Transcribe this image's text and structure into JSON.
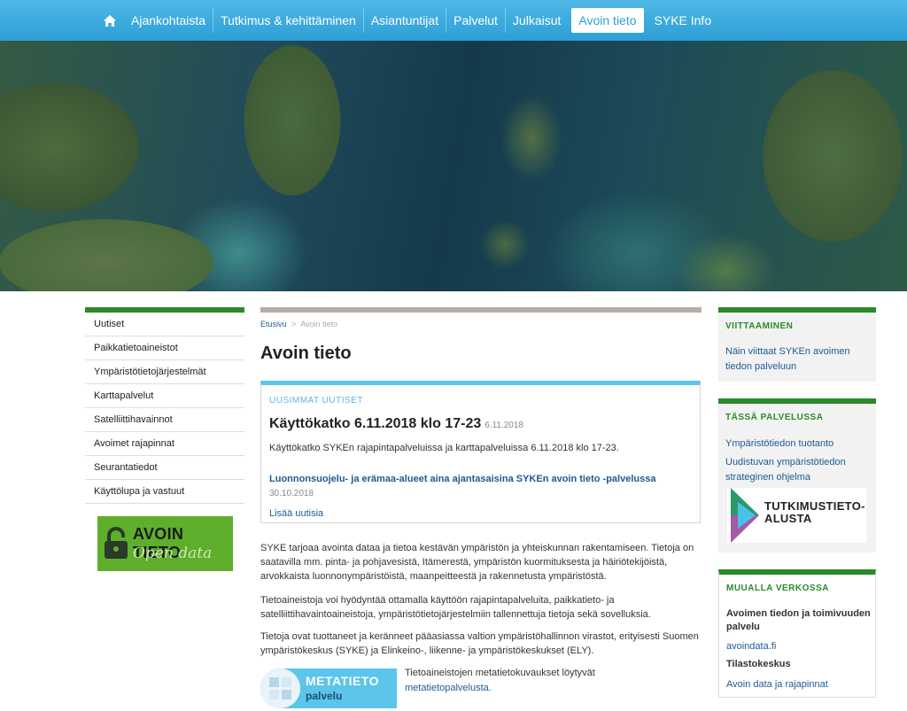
{
  "nav": {
    "home_icon": "home-icon",
    "items": [
      {
        "label": "Ajankohtaista"
      },
      {
        "label": "Tutkimus & kehittäminen"
      },
      {
        "label": "Asiantuntijat"
      },
      {
        "label": "Palvelut"
      },
      {
        "label": "Julkaisut"
      },
      {
        "label": "Avoin tieto",
        "active": true
      },
      {
        "label": "SYKE Info"
      }
    ],
    "bg_color": "#2d9fd6"
  },
  "left_nav": {
    "items": [
      {
        "label": "Uutiset"
      },
      {
        "label": "Paikkatietoaineistot"
      },
      {
        "label": "Ympäristötietojärjestelmät"
      },
      {
        "label": "Karttapalvelut"
      },
      {
        "label": "Satelliittihavainnot"
      },
      {
        "label": "Avoimet rajapinnat"
      },
      {
        "label": "Seurantatiedot"
      },
      {
        "label": "Käyttölupa ja vastuut"
      }
    ],
    "logo_line1": "AVOIN TIETO",
    "logo_line2": "Open data",
    "accent": "#2a8a2a"
  },
  "breadcrumb": {
    "home": "Etusivu",
    "sep": ">",
    "current": "Avoin tieto"
  },
  "page_title": "Avoin tieto",
  "news": {
    "heading": "UUSIMMAT UUTISET",
    "item1_title": "Käyttökatko 6.11.2018 klo 17-23",
    "item1_date": "6.11.2018",
    "item1_body": "Käyttökatko SYKEn rajapintapalveluissa ja karttapalveluissa 6.11.2018 klo 17-23.",
    "item2_title": "Luonnonsuojelu- ja erämaa-alueet aina ajantasaisina SYKEn avoin tieto -palvelussa",
    "item2_date": "30.10.2018",
    "more": "Lisää uutisia"
  },
  "paragraphs": [
    "SYKE tarjoaa avointa dataa ja tietoa kestävän ympäristön ja yhteiskunnan rakentamiseen. Tietoja on saatavilla mm. pinta- ja pohjavesistä, Itämerestä, ympäristön kuormituksesta ja häiriötekijöistä, arvokkaista luonnonympäristöistä, maanpeitteestä ja rakennetusta ympäristöstä.",
    "Tietoaineistoja voi hyödyntää ottamalla käyttöön rajapintapalveluita, paikkatieto- ja satelliittihavaintoaineistoja, ympäristötietojärjestelmiin tallennettuja tietoja sekä sovelluksia.",
    "Tietoja ovat tuottaneet ja keränneet pääasiassa valtion ympäristöhallinnon virastot, erityisesti  Suomen ympäristökeskus (SYKE) ja Elinkeino-, liikenne- ja ympäristökeskukset (ELY)."
  ],
  "meta": {
    "logo_line1": "METATIETO",
    "logo_line2": "palvelu",
    "text": "Tietoaineistojen metatietokuvaukset löytyvät",
    "link": "metatietopalvelusta."
  },
  "sidebar": {
    "viittaaminen": {
      "title": "VIITTAAMINEN",
      "link": "Näin viittaat SYKEn avoimen tiedon palveluun"
    },
    "tassa": {
      "title": "TÄSSÄ PALVELUSSA",
      "link1": "Ympäristötiedon tuotanto",
      "link2": "Uudistuvan ympäristötiedon strateginen ohjelma",
      "logo_line1": "TUTKIMUSTIETO-",
      "logo_line2": "ALUSTA"
    },
    "muualla": {
      "title": "MUUALLA VERKOSSA",
      "bold1": "Avoimen tiedon ja toimivuuden palvelu",
      "link1": "avoindata.fi",
      "bold2": "Tilastokeskus",
      "link2": "Avoin data ja rajapinnat"
    }
  }
}
